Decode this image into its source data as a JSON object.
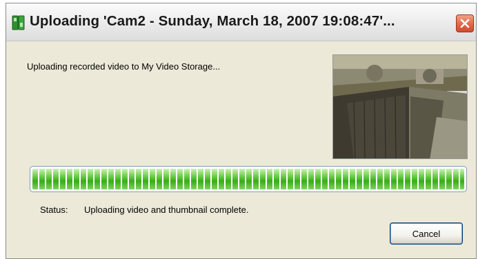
{
  "window": {
    "title": "Uploading 'Cam2 - Sunday, March 18, 2007 19:08:47'..."
  },
  "message": "Uploading recorded video to My Video Storage...",
  "progress": {
    "fraction": 1.0
  },
  "status": {
    "label": "Status:",
    "text": "Uploading video and thumbnail complete."
  },
  "buttons": {
    "cancel_label": "Cancel"
  },
  "icons": {
    "app": "camera-app-icon",
    "close": "close-icon"
  },
  "colors": {
    "progress_fill": "#37ad19",
    "close_button": "#e0684a",
    "dialog_background": "#ece9d8"
  }
}
